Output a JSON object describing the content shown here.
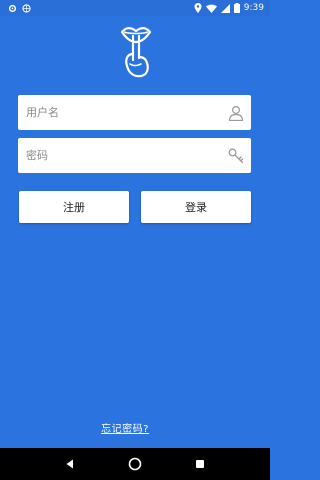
{
  "status_bar": {
    "time": "9:39",
    "left_icons": [
      "settings-icon",
      "globe-icon"
    ],
    "right_icons": [
      "location-icon",
      "wifi-icon",
      "signal-icon",
      "battery-icon"
    ]
  },
  "logo": {
    "icon": "shush-logo-icon"
  },
  "form": {
    "username_placeholder": "用户名",
    "username_value": "",
    "password_placeholder": "密码",
    "password_value": "",
    "username_icon": "user-icon",
    "password_icon": "key-icon"
  },
  "buttons": {
    "register_label": "注册",
    "login_label": "登录"
  },
  "links": {
    "forgot_password": "忘记密码?"
  },
  "nav_bar": {
    "icons": [
      "back-icon",
      "home-icon",
      "recents-icon"
    ]
  },
  "colors": {
    "background": "#2b73df",
    "field_bg": "#ffffff",
    "text_on_bg": "#ffffff"
  }
}
